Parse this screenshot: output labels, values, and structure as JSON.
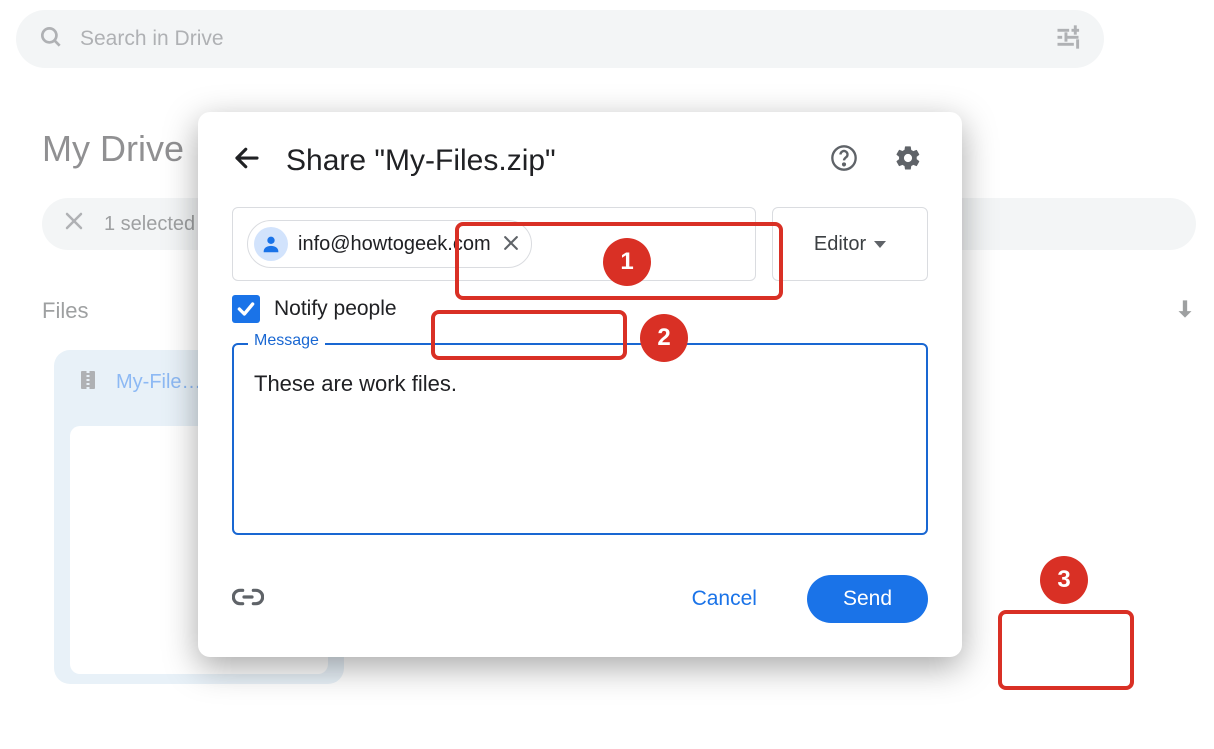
{
  "search": {
    "placeholder": "Search in Drive"
  },
  "page": {
    "title": "My Drive",
    "selection": "1 selected",
    "files_heading": "Files"
  },
  "file": {
    "name": "My-File…"
  },
  "dialog": {
    "title": "Share \"My-Files.zip\"",
    "chip_email": "info@howtogeek.com",
    "role": "Editor",
    "notify_label": "Notify people",
    "message_legend": "Message",
    "message_text": "These are work files.",
    "cancel": "Cancel",
    "send": "Send"
  },
  "annotations": {
    "n1": "1",
    "n2": "2",
    "n3": "3"
  }
}
